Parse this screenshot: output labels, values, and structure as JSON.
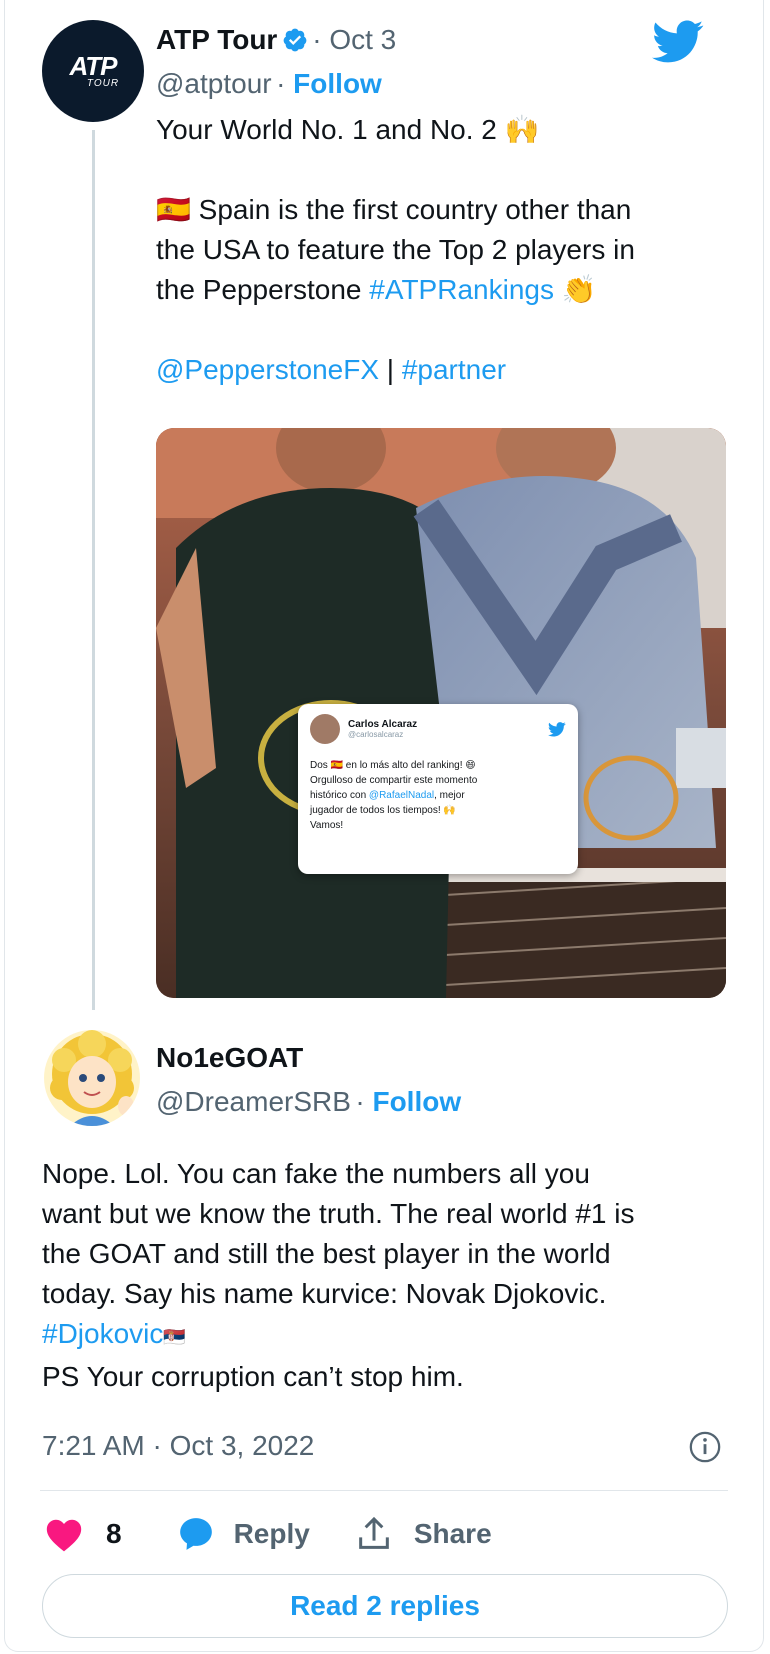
{
  "tweet": {
    "author_name": "ATP Tour",
    "date": "Oct 3",
    "handle": "@atptour",
    "follow_label": "Follow",
    "line1": "Your World No. 1 and No. 2",
    "line1_emoji": "🙌",
    "flag_emoji": "🇪🇸",
    "line2": "Spain is the first country other than",
    "line3": "the USA to feature the Top 2 players in",
    "line4_prefix": "the Pepperstone ",
    "hashtag": "#ATPRankings",
    "line4_emoji": "👏",
    "mention": "@PepperstoneFX",
    "separator": " | ",
    "partner_tag": "#partner",
    "avatar_logo": "ATP",
    "avatar_logo_sub": "TOUR"
  },
  "embedded_card": {
    "name": "Carlos Alcaraz",
    "handle": "@carlosalcaraz",
    "line1": "Dos 🇪🇸 en lo más alto del ranking! 😄",
    "line2": "Orgulloso de compartir este momento",
    "line3_prefix": "histórico con ",
    "line3_mention": "@RafaelNadal",
    "line3_suffix": ", mejor",
    "line4": "jugador de todos los tiempos! 🙌",
    "line5": "Vamos!"
  },
  "reply": {
    "author_name": "No1eGOAT",
    "handle": "@DreamerSRB",
    "follow_label": "Follow",
    "lines": [
      "Nope.  Lol.  You can fake the numbers all you",
      "want but we know the truth.  The real world #1 is",
      "the GOAT and still the best player in the world",
      "today.  Say his name kurvice: Novak Djokovic."
    ],
    "hashtag": "#Djokovic",
    "hashtag_emoji": "🇷🇸",
    "ps_line": "PS Your corruption can’t stop him.",
    "timestamp": "7:21 AM · Oct 3, 2022"
  },
  "actions": {
    "like_count": "8",
    "reply_label": "Reply",
    "share_label": "Share",
    "read_replies_label": "Read 2 replies"
  },
  "colors": {
    "twitter_blue": "#1d9bf0",
    "like_pink": "#f91880",
    "text": "#0f1419",
    "muted": "#536471"
  },
  "icons": [
    "verified-badge-icon",
    "twitter-bird-icon",
    "heart-icon",
    "reply-bubble-icon",
    "share-icon",
    "info-icon"
  ]
}
